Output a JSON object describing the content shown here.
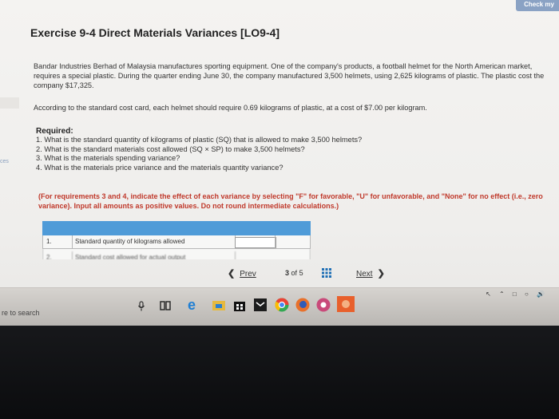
{
  "header": {
    "check_label": "Check my"
  },
  "side_tabs": {
    "tab_a": "",
    "tab_b": "ces"
  },
  "exercise": {
    "title": "Exercise 9-4 Direct Materials Variances [LO9-4]",
    "paragraph1": "Bandar Industries Berhad of Malaysia manufactures sporting equipment. One of the company's products, a football helmet for the North American market, requires a special plastic. During the quarter ending June 30, the company manufactured 3,500 helmets, using 2,625 kilograms of plastic. The plastic cost the company $17,325.",
    "paragraph2": "According to the standard cost card, each helmet should require 0.69 kilograms of plastic, at a cost of $7.00 per kilogram.",
    "required_heading": "Required:",
    "requirements": [
      "1. What is the standard quantity of kilograms of plastic (SQ) that is allowed to make 3,500 helmets?",
      "2. What is the standard materials cost allowed (SQ × SP) to make 3,500 helmets?",
      "3. What is the materials spending variance?",
      "4. What is the materials price variance and the materials quantity variance?"
    ],
    "note": "(For requirements 3 and 4, indicate the effect of each variance by selecting \"F\" for favorable, \"U\" for unfavorable, and \"None\" for no effect (i.e., zero variance). Input all amounts as positive values. Do not round intermediate calculations.)"
  },
  "answer_table": {
    "rows": [
      {
        "num": "1.",
        "label": "Standard quantity of kilograms allowed"
      },
      {
        "num": "2.",
        "label": "Standard cost allowed for actual output"
      }
    ]
  },
  "pager": {
    "prev_label": "Prev",
    "current": "3",
    "of": "of",
    "total": "5",
    "next_label": "Next"
  },
  "taskbar": {
    "search_text": "re to search"
  },
  "colors": {
    "accent_blue": "#4f9bd8",
    "note_red": "#c0392b",
    "check_button": "#8aa2c4"
  }
}
